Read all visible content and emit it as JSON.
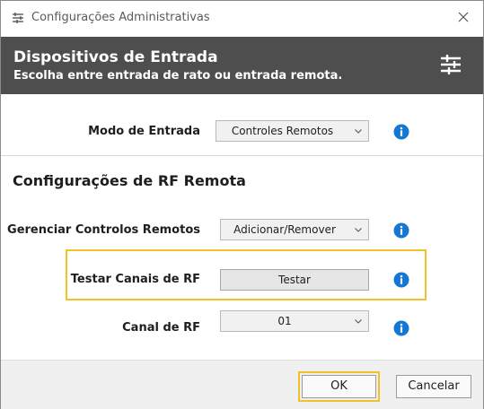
{
  "window": {
    "title": "Configurações Administrativas"
  },
  "banner": {
    "title": "Dispositivos de Entrada",
    "subtitle": "Escolha entre entrada de rato ou entrada remota."
  },
  "input_mode": {
    "label": "Modo de Entrada",
    "value": "Controles Remotos"
  },
  "rf_section": {
    "title": "Configurações de RF Remota"
  },
  "manage_remotes": {
    "label": "Gerenciar Controlos Remotos",
    "value": "Adicionar/Remover"
  },
  "test_rf": {
    "label": "Testar Canais de RF",
    "button": "Testar"
  },
  "rf_channel": {
    "label": "Canal de RF",
    "value": "01"
  },
  "footer": {
    "ok_label": "OK",
    "cancel_label": "Cancelar"
  },
  "colors": {
    "banner_bg": "#4e4e4e",
    "info_blue": "#1477d4",
    "highlight": "#f2c22b"
  },
  "icons": {
    "title": "sliders-icon",
    "close": "close-icon",
    "banner": "sliders-icon",
    "info": "info-icon",
    "dropdown": "chevron-down-icon"
  }
}
